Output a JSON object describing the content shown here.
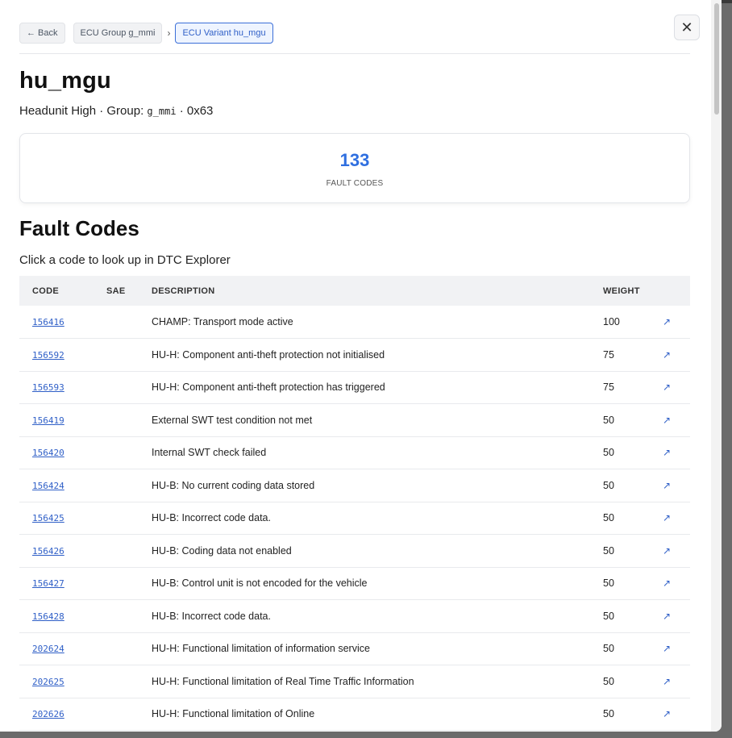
{
  "breadcrumb": {
    "back_label": "← Back",
    "group_label": "ECU Group g_mmi",
    "separator": "›",
    "variant_label": "ECU Variant hu_mgu"
  },
  "close_label": "✕",
  "title": "hu_mgu",
  "subtitle": {
    "prefix": "Headunit High · Group: ",
    "group_code": "g_mmi",
    "suffix": " · 0x63"
  },
  "stats": {
    "value": "133",
    "label": "FAULT CODES"
  },
  "section": {
    "title": "Fault Codes",
    "hint": "Click a code to look up in DTC Explorer"
  },
  "table": {
    "headers": {
      "code": "CODE",
      "sae": "SAE",
      "description": "DESCRIPTION",
      "weight": "WEIGHT"
    },
    "rows": [
      {
        "code": "156416",
        "sae": "",
        "description": "CHAMP: Transport mode active",
        "weight": "100"
      },
      {
        "code": "156592",
        "sae": "",
        "description": "HU-H: Component anti-theft protection not initialised",
        "weight": "75"
      },
      {
        "code": "156593",
        "sae": "",
        "description": "HU-H: Component anti-theft protection has triggered",
        "weight": "75"
      },
      {
        "code": "156419",
        "sae": "",
        "description": "External SWT test condition not met",
        "weight": "50"
      },
      {
        "code": "156420",
        "sae": "",
        "description": "Internal SWT check failed",
        "weight": "50"
      },
      {
        "code": "156424",
        "sae": "",
        "description": "HU-B: No current coding data stored",
        "weight": "50"
      },
      {
        "code": "156425",
        "sae": "",
        "description": "HU-B: Incorrect code data.",
        "weight": "50"
      },
      {
        "code": "156426",
        "sae": "",
        "description": "HU-B: Coding data not enabled",
        "weight": "50"
      },
      {
        "code": "156427",
        "sae": "",
        "description": "HU-B: Control unit is not encoded for the vehicle",
        "weight": "50"
      },
      {
        "code": "156428",
        "sae": "",
        "description": "HU-B: Incorrect code data.",
        "weight": "50"
      },
      {
        "code": "202624",
        "sae": "",
        "description": "HU-H: Functional limitation of information service",
        "weight": "50"
      },
      {
        "code": "202625",
        "sae": "",
        "description": "HU-H: Functional limitation of Real Time Traffic Information",
        "weight": "50"
      },
      {
        "code": "202626",
        "sae": "",
        "description": "HU-H: Functional limitation of Online",
        "weight": "50"
      }
    ],
    "row_link_icon": "↗"
  }
}
